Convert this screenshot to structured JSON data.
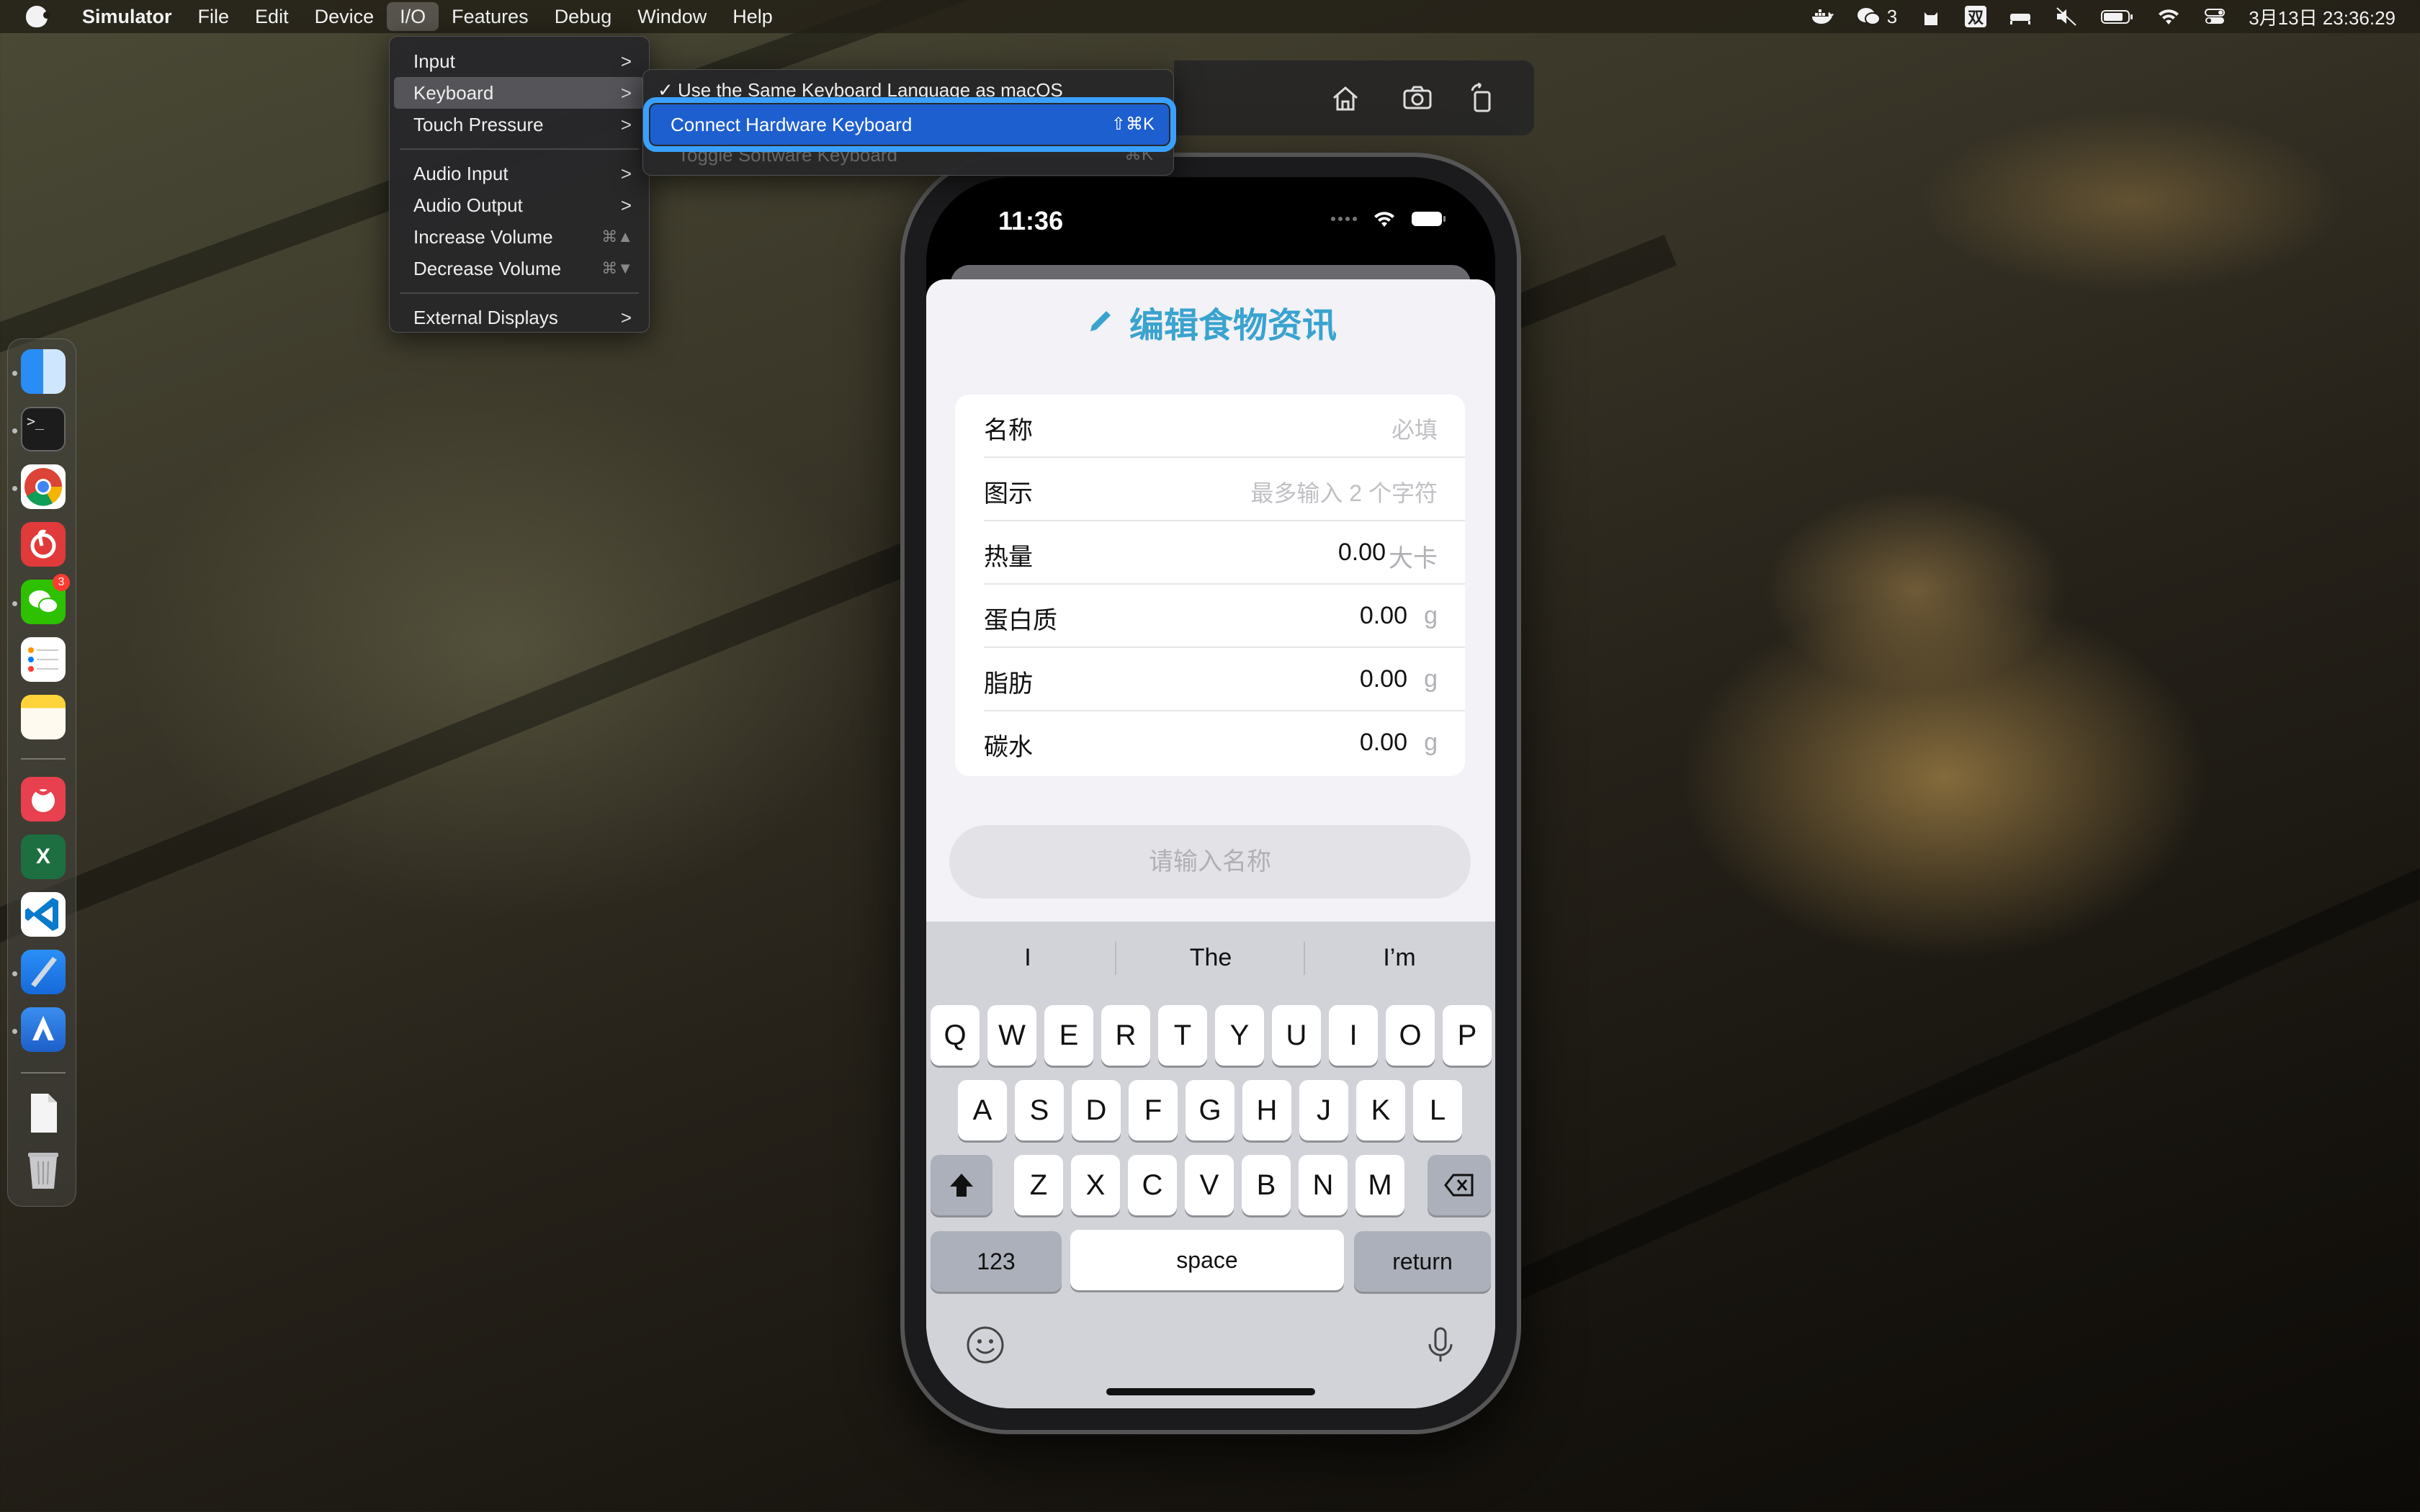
{
  "menubar": {
    "app_name": "Simulator",
    "menus": [
      "File",
      "Edit",
      "Device",
      "I/O",
      "Features",
      "Debug",
      "Window",
      "Help"
    ],
    "wechat_count": "3",
    "input_method": "双",
    "clock": "3月13日 23:36:29"
  },
  "io_menu": {
    "items": [
      {
        "label": "Input",
        "arrow": ">"
      },
      {
        "label": "Keyboard",
        "arrow": ">"
      },
      {
        "label": "Touch Pressure",
        "arrow": ">"
      },
      {
        "label": "Audio Input",
        "arrow": ">"
      },
      {
        "label": "Audio Output",
        "arrow": ">"
      },
      {
        "label": "Increase Volume",
        "shortcut": "⌘▲"
      },
      {
        "label": "Decrease Volume",
        "shortcut": "⌘▼"
      },
      {
        "label": "External Displays",
        "arrow": ">"
      }
    ]
  },
  "keyboard_menu": {
    "items": [
      {
        "label": "Use the Same Keyboard Language as macOS",
        "check": "✓"
      },
      {
        "label": "Connect Hardware Keyboard",
        "shortcut": "⇧⌘K"
      },
      {
        "label": "Toggle Software Keyboard",
        "shortcut": "⌘K"
      }
    ]
  },
  "dock": {
    "wechat_badge": "3"
  },
  "phone": {
    "time": "11:36",
    "title": "编辑食物资讯",
    "fields": [
      {
        "label": "名称",
        "placeholder": "必填"
      },
      {
        "label": "图示",
        "placeholder": "最多输入 2 个字符"
      },
      {
        "label": "热量",
        "value": "0.00",
        "unit": "大卡"
      },
      {
        "label": "蛋白质",
        "value": "0.00",
        "unit": "g"
      },
      {
        "label": "脂肪",
        "value": "0.00",
        "unit": "g"
      },
      {
        "label": "碳水",
        "value": "0.00",
        "unit": "g"
      }
    ],
    "submit_label": "请输入名称",
    "suggestions": [
      "I",
      "The",
      "I’m"
    ],
    "keys": {
      "row1": [
        "Q",
        "W",
        "E",
        "R",
        "T",
        "Y",
        "U",
        "I",
        "O",
        "P"
      ],
      "row2": [
        "A",
        "S",
        "D",
        "F",
        "G",
        "H",
        "J",
        "K",
        "L"
      ],
      "row3": [
        "Z",
        "X",
        "C",
        "V",
        "B",
        "N",
        "M"
      ],
      "numbers": "123",
      "space": "space",
      "return": "return"
    }
  }
}
